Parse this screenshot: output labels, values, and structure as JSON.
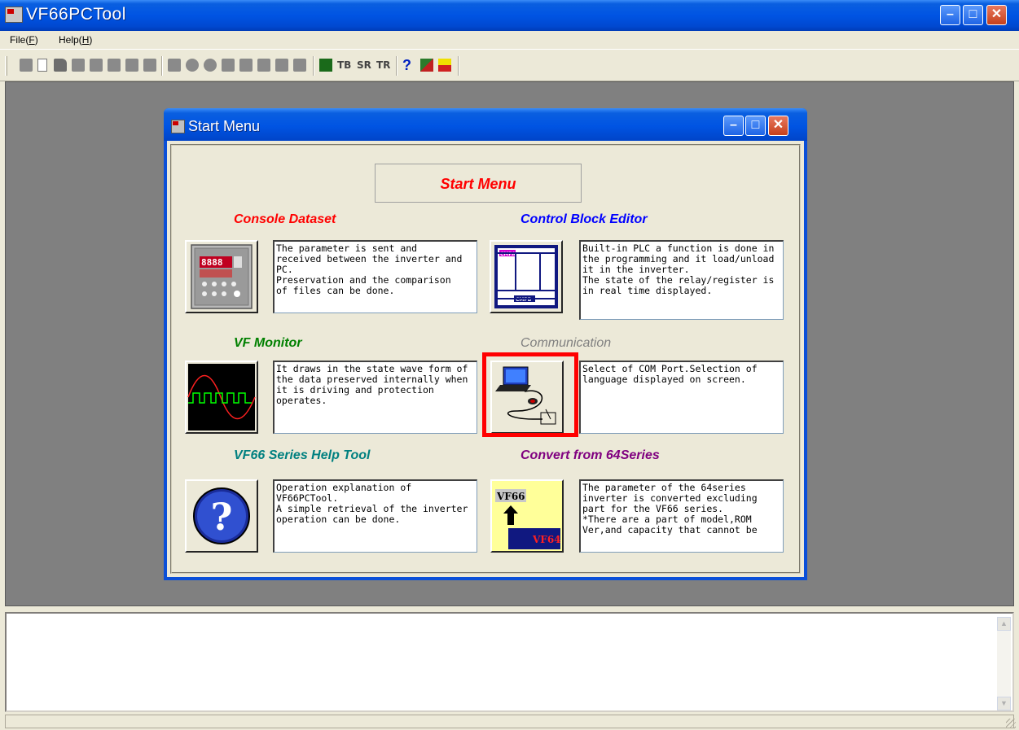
{
  "app": {
    "title": "VF66PCTool",
    "title_icon": "app-icon"
  },
  "menu": [
    {
      "label": "File(F)",
      "pre": "File(",
      "key": "F",
      "post": ")"
    },
    {
      "label": "Help(H)",
      "pre": "Help(",
      "key": "H",
      "post": ")"
    }
  ],
  "toolbar": {
    "icons": [
      "console-icon",
      "new-icon",
      "open-icon",
      "print-icon",
      "save-icon",
      "cut-icon",
      "copy-icon",
      "paste-icon",
      "grid-icon",
      "zoom-in-icon",
      "zoom-out-icon",
      "upload-icon",
      "download-icon",
      "print2-icon",
      "copy2-icon",
      "paste2-icon",
      "monitor-icon",
      "help-icon",
      "language-icon",
      "exit-icon"
    ],
    "tb_label": "TB",
    "sr_label": "SR",
    "tr_label": "TR",
    "help_label": "?"
  },
  "child_window": {
    "title": "Start Menu",
    "header": "Start Menu",
    "sections": {
      "console": {
        "title": "Console Dataset",
        "color": "#ff0000",
        "description": "The parameter is sent and\nreceived between the inverter and\nPC.\nPreservation and the comparison\nof files can be done."
      },
      "control_block": {
        "title": "Control Block Editor",
        "color": "#0000ff",
        "description": "Built-in PLC a function is done in\nthe programming and it load/unload\nit in the inverter.\nThe state of the relay/register is\nin real time displayed."
      },
      "vf_monitor": {
        "title": "VF Monitor",
        "color": "#008000",
        "description": "It draws in the state wave form of\nthe data preserved internally when\nit is driving and protection\noperates."
      },
      "communication": {
        "title": "Communication",
        "color": "#808080",
        "description": "Select of COM Port.Selection of\nlanguage displayed on screen."
      },
      "help_tool": {
        "title": "VF66 Series Help Tool",
        "color": "#008080",
        "description": "Operation explanation of\nVF66PCTool.\nA simple retrieval of the inverter\noperation can be done."
      },
      "convert": {
        "title": "Convert from 64Series",
        "color": "#800080",
        "description": "The parameter of the 64series\ninverter is converted excluding\npart for the VF66 series.\n*There are a part of model,ROM\nVer,and capacity that cannot be",
        "badge_top": "VF66",
        "badge_bottom": "VF64"
      }
    },
    "icon_texts": {
      "console_display": "8888",
      "cmpa": "CMPA",
      "cmpb": "CMPB",
      "k": "K",
      "help_symbol": "?"
    }
  },
  "colors": {
    "highlight": "#ff0000",
    "titlebar": "#0054e3"
  }
}
